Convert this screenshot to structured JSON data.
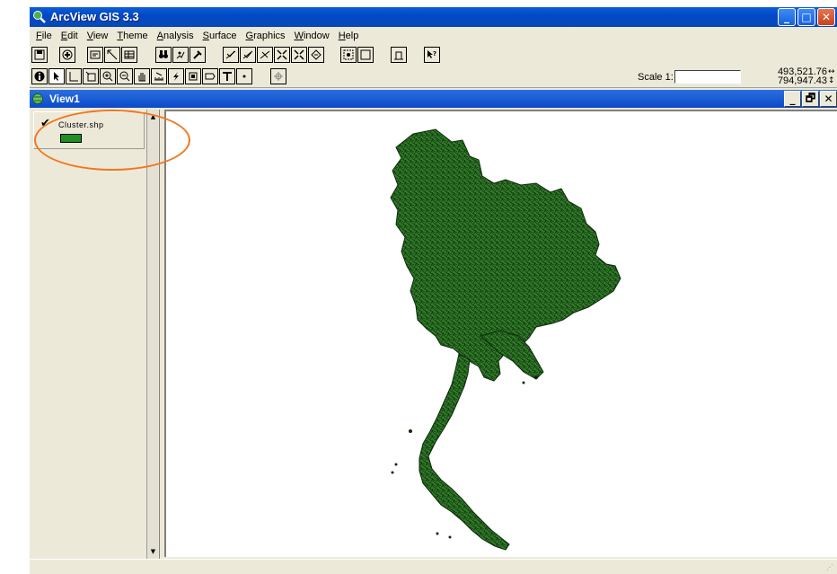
{
  "window": {
    "title": "ArcView GIS 3.3",
    "minimize": "_",
    "maximize": "□",
    "close": "✕"
  },
  "menu": [
    {
      "key": "F",
      "rest": "ile"
    },
    {
      "key": "E",
      "rest": "dit"
    },
    {
      "key": "V",
      "rest": "iew"
    },
    {
      "key": "T",
      "rest": "heme"
    },
    {
      "key": "A",
      "rest": "nalysis"
    },
    {
      "key": "S",
      "rest": "urface"
    },
    {
      "key": "G",
      "rest": "raphics"
    },
    {
      "key": "W",
      "rest": "indow"
    },
    {
      "key": "H",
      "rest": "elp"
    }
  ],
  "toolbar2": {
    "scale_label": "Scale 1:",
    "scale_value": "",
    "coord_x": "493,521.76",
    "coord_y": "794,947.43",
    "coord_x_arrow": "↔",
    "coord_y_arrow": "↕"
  },
  "view": {
    "title": "View1",
    "minimize": "_",
    "restore": "🗗",
    "close": "✕"
  },
  "toc": {
    "theme_name": "Cluster.shp",
    "theme_checked": "✔",
    "scroll_up": "▲",
    "scroll_down": "▼"
  },
  "colors": {
    "theme_fill": "#1f8f1f",
    "map_fill": "#2f7a28",
    "annotation": "#f07820"
  },
  "statusbar": {
    "grip": "⋰"
  }
}
